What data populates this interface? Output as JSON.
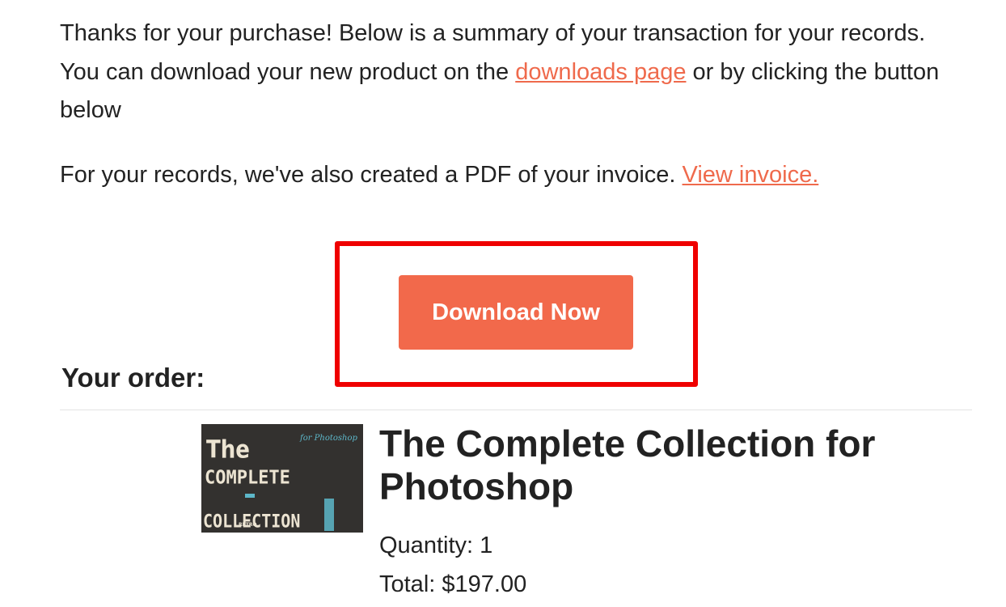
{
  "intro": {
    "text_before_link": "Thanks for your purchase! Below is a summary of your transaction for your records. You can download your new product on the ",
    "downloads_link": "downloads page",
    "text_after_link": " or by clicking the button below"
  },
  "invoice": {
    "text": "For your records, we've also created a PDF of your invoice. ",
    "link": "View invoice."
  },
  "download_button": {
    "label": "Download Now"
  },
  "order": {
    "heading": "Your order:",
    "product": {
      "image_label": {
        "subtitle": "for Photoshop",
        "line1": "The",
        "line2": "COMPLETE",
        "line3": "COLLECTION",
        "badge": "RETRO"
      },
      "title": "The Complete Collection for Photoshop",
      "quantity_label": "Quantity:",
      "quantity": "1",
      "total_label": "Total:",
      "total": "$197.00"
    }
  },
  "colors": {
    "accent": "#f2694b",
    "link": "#ef6a4c",
    "highlight": "#ef0000",
    "text": "#222222"
  }
}
